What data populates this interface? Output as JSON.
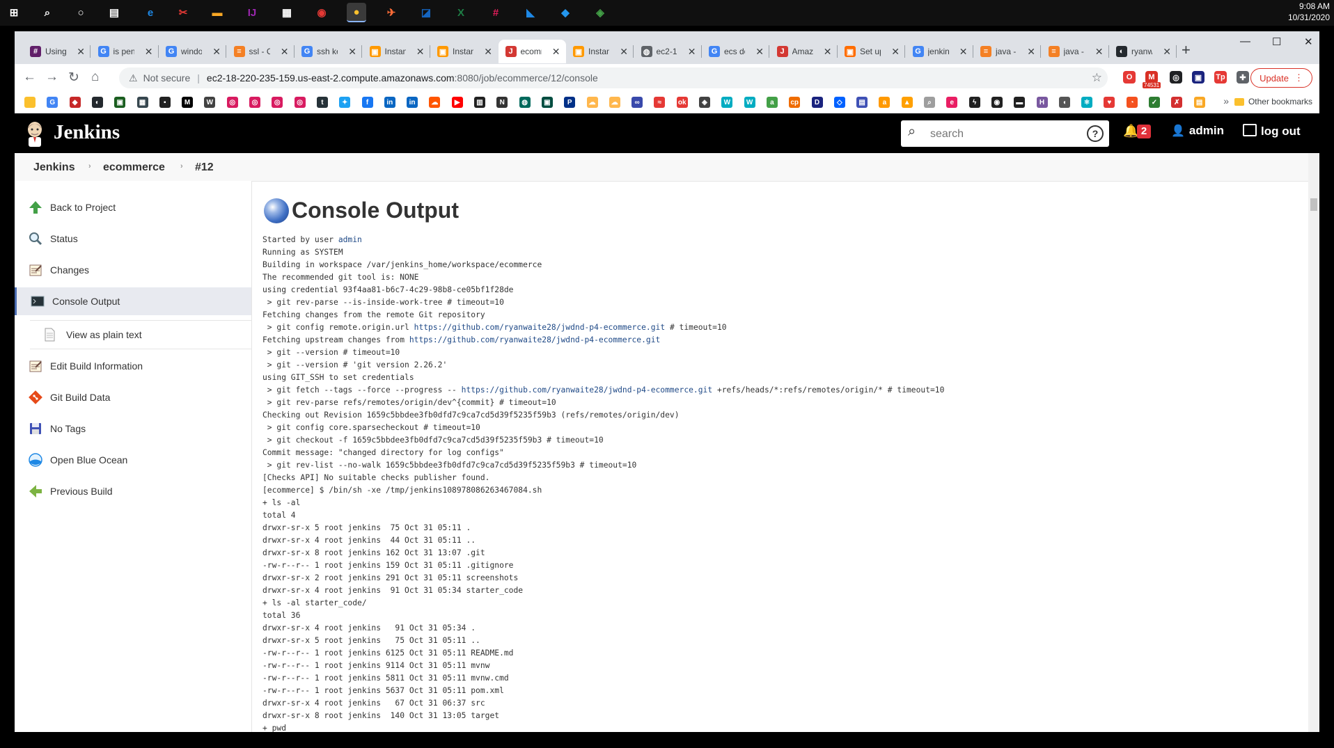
{
  "taskbar": {
    "icons": [
      {
        "name": "windows-start-icon",
        "glyph": "⊞",
        "color": "#ffffff"
      },
      {
        "name": "search-icon",
        "glyph": "⌕",
        "color": "#ffffff"
      },
      {
        "name": "cortana-icon",
        "glyph": "○",
        "color": "#ffffff"
      },
      {
        "name": "task-view-icon",
        "glyph": "▤",
        "color": "#ffffff"
      },
      {
        "name": "edge-icon",
        "glyph": "e",
        "color": "#1e88e5"
      },
      {
        "name": "snipping-tool-icon",
        "glyph": "✂",
        "color": "#e53935"
      },
      {
        "name": "file-explorer-icon",
        "glyph": "▬",
        "color": "#f9a825"
      },
      {
        "name": "intellij-icon",
        "glyph": "IJ",
        "color": "#9c27b0"
      },
      {
        "name": "store-icon",
        "glyph": "▦",
        "color": "#ffffff"
      },
      {
        "name": "among-us-icon",
        "glyph": "◉",
        "color": "#e53935"
      },
      {
        "name": "chrome-icon",
        "glyph": "●",
        "color": "#fbc02d"
      },
      {
        "name": "postman-icon",
        "glyph": "✈",
        "color": "#ff6c37"
      },
      {
        "name": "remote-desktop-icon",
        "glyph": "◪",
        "color": "#1565c0"
      },
      {
        "name": "excel-icon",
        "glyph": "X",
        "color": "#1e7e45"
      },
      {
        "name": "slack-icon",
        "glyph": "#",
        "color": "#e01e5a"
      },
      {
        "name": "vscode-icon",
        "glyph": "◣",
        "color": "#1e88e5"
      },
      {
        "name": "docker-icon",
        "glyph": "◆",
        "color": "#2496ed"
      },
      {
        "name": "sourcetree-icon",
        "glyph": "◈",
        "color": "#43a047"
      }
    ],
    "time": "9:08 AM",
    "date": "10/31/2020"
  },
  "tabs": [
    {
      "title": "Using",
      "icon": "slack-favicon-icon",
      "color": "#611f69",
      "glyph": "#"
    },
    {
      "title": "is pen",
      "icon": "google-favicon-icon",
      "color": "#4285f4",
      "glyph": "G"
    },
    {
      "title": "windo",
      "icon": "google-favicon-icon",
      "color": "#4285f4",
      "glyph": "G"
    },
    {
      "title": "ssl - C",
      "icon": "stackoverflow-favicon-icon",
      "color": "#f48024",
      "glyph": "≡"
    },
    {
      "title": "ssh ke",
      "icon": "google-favicon-icon",
      "color": "#4285f4",
      "glyph": "G"
    },
    {
      "title": "Instan",
      "icon": "aws-favicon-icon",
      "color": "#ff9900",
      "glyph": "▣"
    },
    {
      "title": "Instan",
      "icon": "aws-favicon-icon",
      "color": "#ff9900",
      "glyph": "▣"
    },
    {
      "title": "ecomm",
      "icon": "jenkins-favicon-icon",
      "color": "#d33833",
      "glyph": "J"
    },
    {
      "title": "Instan",
      "icon": "aws-favicon-icon",
      "color": "#ff9900",
      "glyph": "▣"
    },
    {
      "title": "ec2-1",
      "icon": "globe-favicon-icon",
      "color": "#5f6368",
      "glyph": "◍"
    },
    {
      "title": "ecs do",
      "icon": "google-favicon-icon",
      "color": "#4285f4",
      "glyph": "G"
    },
    {
      "title": "Amazo",
      "icon": "jenkins-favicon-icon",
      "color": "#d33833",
      "glyph": "J"
    },
    {
      "title": "Set up",
      "icon": "aws-favicon-icon",
      "color": "#ff6d00",
      "glyph": "▣"
    },
    {
      "title": "jenkin",
      "icon": "google-favicon-icon",
      "color": "#4285f4",
      "glyph": "G"
    },
    {
      "title": "java -",
      "icon": "stackoverflow-favicon-icon",
      "color": "#f48024",
      "glyph": "≡"
    },
    {
      "title": "java -",
      "icon": "stackoverflow-favicon-icon",
      "color": "#f48024",
      "glyph": "≡"
    },
    {
      "title": "ryanw",
      "icon": "github-favicon-icon",
      "color": "#24292e",
      "glyph": "◐"
    }
  ],
  "active_tab_index": 7,
  "new_tab_label": "+",
  "window_controls": {
    "minimize": "—",
    "maximize": "☐",
    "close": "✕"
  },
  "toolbar": {
    "back": "←",
    "forward": "→",
    "reload": "↻",
    "home": "⌂",
    "security_icon": "⚠",
    "not_secure": "Not secure",
    "url_host": "ec2-18-220-235-159.us-east-2.compute.amazonaws.com",
    "url_path": ":8080/job/ecommerce/12/console",
    "star": "☆",
    "update_label": "Update",
    "update_menu": "⋮",
    "gmail_count": "74531"
  },
  "extensions": [
    {
      "name": "opera-extension-icon",
      "color": "#e53935",
      "glyph": "O"
    },
    {
      "name": "gmail-extension-icon",
      "color": "#d93025",
      "glyph": "M"
    },
    {
      "name": "record-extension-icon",
      "color": "#202124",
      "glyph": "◎"
    },
    {
      "name": "terminal-extension-icon",
      "color": "#1a237e",
      "glyph": "▣"
    },
    {
      "name": "tp-extension-icon",
      "color": "#e53935",
      "glyph": "Tp"
    },
    {
      "name": "puzzle-extension-icon",
      "color": "#5f6368",
      "glyph": "✚"
    },
    {
      "name": "profile-avatar-icon",
      "color": "#2e7d32",
      "glyph": "◕"
    }
  ],
  "bookmarks": [
    {
      "name": "bookmark-folder-icon",
      "color": "#fbc02d",
      "glyph": ""
    },
    {
      "name": "google-bookmark-icon",
      "color": "#4285f4",
      "glyph": "G"
    },
    {
      "name": "red-app-bookmark-icon",
      "color": "#c62828",
      "glyph": "◆"
    },
    {
      "name": "github-bookmark-icon",
      "color": "#24292e",
      "glyph": "◐"
    },
    {
      "name": "terminal-bookmark-icon",
      "color": "#1b5e20",
      "glyph": "▣"
    },
    {
      "name": "grid-bookmark-icon",
      "color": "#37474f",
      "glyph": "▦"
    },
    {
      "name": "dark-bookmark-icon",
      "color": "#212121",
      "glyph": "▪"
    },
    {
      "name": "medium-bookmark-icon",
      "color": "#000000",
      "glyph": "M"
    },
    {
      "name": "wiki-bookmark-icon",
      "color": "#424242",
      "glyph": "W"
    },
    {
      "name": "instagram-bookmark-icon",
      "color": "#d81b60",
      "glyph": "◎"
    },
    {
      "name": "instagram-bookmark-icon",
      "color": "#d81b60",
      "glyph": "◎"
    },
    {
      "name": "instagram-bookmark-icon",
      "color": "#d81b60",
      "glyph": "◎"
    },
    {
      "name": "instagram-bookmark-icon",
      "color": "#d81b60",
      "glyph": "◎"
    },
    {
      "name": "tumblr-bookmark-icon",
      "color": "#263238",
      "glyph": "t"
    },
    {
      "name": "twitter-bookmark-icon",
      "color": "#1da1f2",
      "glyph": "✦"
    },
    {
      "name": "facebook-bookmark-icon",
      "color": "#1877f2",
      "glyph": "f"
    },
    {
      "name": "linkedin-bookmark-icon",
      "color": "#0a66c2",
      "glyph": "in"
    },
    {
      "name": "linkedin-bookmark-icon",
      "color": "#0a66c2",
      "glyph": "in"
    },
    {
      "name": "soundcloud-bookmark-icon",
      "color": "#ff5500",
      "glyph": "☁"
    },
    {
      "name": "youtube-bookmark-icon",
      "color": "#ff0000",
      "glyph": "▶"
    },
    {
      "name": "imdb-bookmark-icon",
      "color": "#212121",
      "glyph": "▥"
    },
    {
      "name": "notion-bookmark-icon",
      "color": "#333333",
      "glyph": "N"
    },
    {
      "name": "circle-bookmark-icon",
      "color": "#00695c",
      "glyph": "◍"
    },
    {
      "name": "square-bookmark-icon",
      "color": "#004d40",
      "glyph": "▣"
    },
    {
      "name": "paypal-bookmark-icon",
      "color": "#003087",
      "glyph": "P"
    },
    {
      "name": "cloud-bookmark-icon",
      "color": "#ffb74d",
      "glyph": "☁"
    },
    {
      "name": "cloud-bookmark-icon",
      "color": "#ffb74d",
      "glyph": "☁"
    },
    {
      "name": "link-bookmark-icon",
      "color": "#3949ab",
      "glyph": "∞"
    },
    {
      "name": "wavy-bookmark-icon",
      "color": "#e53935",
      "glyph": "≈"
    },
    {
      "name": "ok-bookmark-icon",
      "color": "#e53935",
      "glyph": "ok"
    },
    {
      "name": "diamond-bookmark-icon",
      "color": "#424242",
      "glyph": "◈"
    },
    {
      "name": "w-bookmark-icon",
      "color": "#00acc1",
      "glyph": "W"
    },
    {
      "name": "w-bookmark-icon",
      "color": "#00acc1",
      "glyph": "W"
    },
    {
      "name": "a-bookmark-icon",
      "color": "#43a047",
      "glyph": "a"
    },
    {
      "name": "cp-bookmark-icon",
      "color": "#ef6c00",
      "glyph": "cp"
    },
    {
      "name": "d-bookmark-icon",
      "color": "#1a237e",
      "glyph": "D"
    },
    {
      "name": "dropbox-bookmark-icon",
      "color": "#0061ff",
      "glyph": "◇"
    },
    {
      "name": "bag-bookmark-icon",
      "color": "#3f51b5",
      "glyph": "▤"
    },
    {
      "name": "amazon-bookmark-icon",
      "color": "#ff9900",
      "glyph": "a"
    },
    {
      "name": "flame-bookmark-icon",
      "color": "#ffa000",
      "glyph": "▲"
    },
    {
      "name": "search-bookmark-icon",
      "color": "#9e9e9e",
      "glyph": "⌕"
    },
    {
      "name": "e-bookmark-icon",
      "color": "#e91e63",
      "glyph": "e"
    },
    {
      "name": "bolt-bookmark-icon",
      "color": "#212121",
      "glyph": "ϟ"
    },
    {
      "name": "alien-bookmark-icon",
      "color": "#212121",
      "glyph": "◉"
    },
    {
      "name": "car-bookmark-icon",
      "color": "#212121",
      "glyph": "▬"
    },
    {
      "name": "heroku-bookmark-icon",
      "color": "#79589f",
      "glyph": "H"
    },
    {
      "name": "apple-bookmark-icon",
      "color": "#555555",
      "glyph": "◖"
    },
    {
      "name": "react-bookmark-icon",
      "color": "#00acc1",
      "glyph": "⚛"
    },
    {
      "name": "heart-bookmark-icon",
      "color": "#e53935",
      "glyph": "♥"
    },
    {
      "name": "power-bookmark-icon",
      "color": "#f4511e",
      "glyph": "◔"
    },
    {
      "name": "check-bookmark-icon",
      "color": "#2e7d32",
      "glyph": "✓"
    },
    {
      "name": "x-bookmark-icon",
      "color": "#d32f2f",
      "glyph": "✗"
    },
    {
      "name": "folder-bookmark-icon",
      "color": "#f9a825",
      "glyph": "▤"
    }
  ],
  "other_bookmarks": "Other bookmarks",
  "bookmarks_overflow": "»",
  "jenkins": {
    "title": "Jenkins",
    "search_placeholder": "search",
    "help_glyph": "?",
    "bell_glyph": "🔔",
    "notification_count": "2",
    "user": "admin",
    "logout": "log out",
    "breadcrumb": [
      "Jenkins",
      "ecommerce",
      "#12"
    ],
    "breadcrumb_sep": "›",
    "sidebar": [
      {
        "label": "Back to Project",
        "icon": "up-arrow-icon"
      },
      {
        "label": "Status",
        "icon": "magnifier-icon"
      },
      {
        "label": "Changes",
        "icon": "notepad-icon"
      },
      {
        "label": "Console Output",
        "icon": "terminal-icon"
      },
      {
        "label": "View as plain text",
        "icon": "document-icon"
      },
      {
        "label": "Edit Build Information",
        "icon": "notepad-icon"
      },
      {
        "label": "Git Build Data",
        "icon": "git-icon"
      },
      {
        "label": "No Tags",
        "icon": "floppy-disk-icon"
      },
      {
        "label": "Open Blue Ocean",
        "icon": "blue-ocean-icon"
      },
      {
        "label": "Previous Build",
        "icon": "left-arrow-icon"
      }
    ],
    "page_title": "Console Output",
    "console_lines": [
      {
        "pre": "Started by user ",
        "link": "admin",
        "post": ""
      },
      {
        "pre": "Running as SYSTEM"
      },
      {
        "pre": "Building in workspace /var/jenkins_home/workspace/ecommerce"
      },
      {
        "pre": "The recommended git tool is: NONE"
      },
      {
        "pre": "using credential 93f4aa81-b6c7-4c29-98b8-ce05bf1f28de"
      },
      {
        "pre": " > git rev-parse --is-inside-work-tree # timeout=10"
      },
      {
        "pre": "Fetching changes from the remote Git repository"
      },
      {
        "pre": " > git config remote.origin.url ",
        "link": "https://github.com/ryanwaite28/jwdnd-p4-ecommerce.git",
        "post": " # timeout=10"
      },
      {
        "pre": "Fetching upstream changes from ",
        "link": "https://github.com/ryanwaite28/jwdnd-p4-ecommerce.git",
        "post": ""
      },
      {
        "pre": " > git --version # timeout=10"
      },
      {
        "pre": " > git --version # 'git version 2.26.2'"
      },
      {
        "pre": "using GIT_SSH to set credentials"
      },
      {
        "pre": " > git fetch --tags --force --progress -- ",
        "link": "https://github.com/ryanwaite28/jwdnd-p4-ecommerce.git",
        "post": " +refs/heads/*:refs/remotes/origin/* # timeout=10"
      },
      {
        "pre": " > git rev-parse refs/remotes/origin/dev^{commit} # timeout=10"
      },
      {
        "pre": "Checking out Revision 1659c5bbdee3fb0dfd7c9ca7cd5d39f5235f59b3 (refs/remotes/origin/dev)"
      },
      {
        "pre": " > git config core.sparsecheckout # timeout=10"
      },
      {
        "pre": " > git checkout -f 1659c5bbdee3fb0dfd7c9ca7cd5d39f5235f59b3 # timeout=10"
      },
      {
        "pre": "Commit message: \"changed directory for log configs\""
      },
      {
        "pre": " > git rev-list --no-walk 1659c5bbdee3fb0dfd7c9ca7cd5d39f5235f59b3 # timeout=10"
      },
      {
        "pre": "[Checks API] No suitable checks publisher found."
      },
      {
        "pre": "[ecommerce] $ /bin/sh -xe /tmp/jenkins108978086263467084.sh"
      },
      {
        "pre": "+ ls -al"
      },
      {
        "pre": "total 4"
      },
      {
        "pre": "drwxr-sr-x 5 root jenkins  75 Oct 31 05:11 ."
      },
      {
        "pre": "drwxr-sr-x 4 root jenkins  44 Oct 31 05:11 .."
      },
      {
        "pre": "drwxr-sr-x 8 root jenkins 162 Oct 31 13:07 .git"
      },
      {
        "pre": "-rw-r--r-- 1 root jenkins 159 Oct 31 05:11 .gitignore"
      },
      {
        "pre": "drwxr-sr-x 2 root jenkins 291 Oct 31 05:11 screenshots"
      },
      {
        "pre": "drwxr-sr-x 4 root jenkins  91 Oct 31 05:34 starter_code"
      },
      {
        "pre": "+ ls -al starter_code/"
      },
      {
        "pre": "total 36"
      },
      {
        "pre": "drwxr-sr-x 4 root jenkins   91 Oct 31 05:34 ."
      },
      {
        "pre": "drwxr-sr-x 5 root jenkins   75 Oct 31 05:11 .."
      },
      {
        "pre": "-rw-r--r-- 1 root jenkins 6125 Oct 31 05:11 README.md"
      },
      {
        "pre": "-rw-r--r-- 1 root jenkins 9114 Oct 31 05:11 mvnw"
      },
      {
        "pre": "-rw-r--r-- 1 root jenkins 5811 Oct 31 05:11 mvnw.cmd"
      },
      {
        "pre": "-rw-r--r-- 1 root jenkins 5637 Oct 31 05:11 pom.xml"
      },
      {
        "pre": "drwxr-sr-x 4 root jenkins   67 Oct 31 06:37 src"
      },
      {
        "pre": "drwxr-sr-x 8 root jenkins  140 Oct 31 13:05 target"
      },
      {
        "pre": "+ pwd"
      }
    ]
  },
  "colors": {
    "jenkins_header": "#000000",
    "link": "#204a87",
    "active_sidebar": "#e8eaf0",
    "notification_badge": "#e0313a",
    "update_button": "#d93025"
  }
}
